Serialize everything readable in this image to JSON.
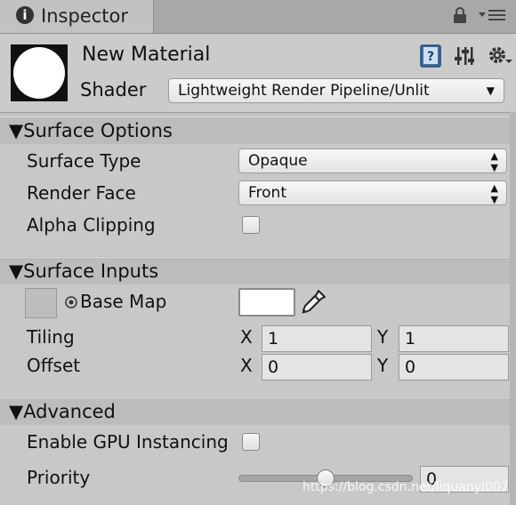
{
  "tab": {
    "icon": "info-icon",
    "icon_glyph": "i",
    "title": "Inspector"
  },
  "header": {
    "material_name": "New Material",
    "shader_label": "Shader",
    "shader_value": "Lightweight Render Pipeline/Unlit"
  },
  "sections": {
    "surface_options": {
      "title": "Surface Options",
      "surface_type_label": "Surface Type",
      "surface_type_value": "Opaque",
      "render_face_label": "Render Face",
      "render_face_value": "Front",
      "alpha_clipping_label": "Alpha Clipping",
      "alpha_clipping_checked": false
    },
    "surface_inputs": {
      "title": "Surface Inputs",
      "base_map_label": "Base Map",
      "base_color": "#ffffff",
      "tiling_label": "Tiling",
      "tiling_x": "1",
      "tiling_y": "1",
      "offset_label": "Offset",
      "offset_x": "0",
      "offset_y": "0",
      "x_label": "X",
      "y_label": "Y"
    },
    "advanced": {
      "title": "Advanced",
      "gpu_instancing_label": "Enable GPU Instancing",
      "gpu_instancing_checked": false,
      "priority_label": "Priority",
      "priority_value": "0",
      "priority_slider_fraction": 0.5
    }
  },
  "watermark": "https://blog.csdn.net/liquanyi007",
  "colors": {
    "panel_bg": "#c2c2c2",
    "section_header": "#bcbcbc",
    "field_bg": "#e4e4e4"
  }
}
